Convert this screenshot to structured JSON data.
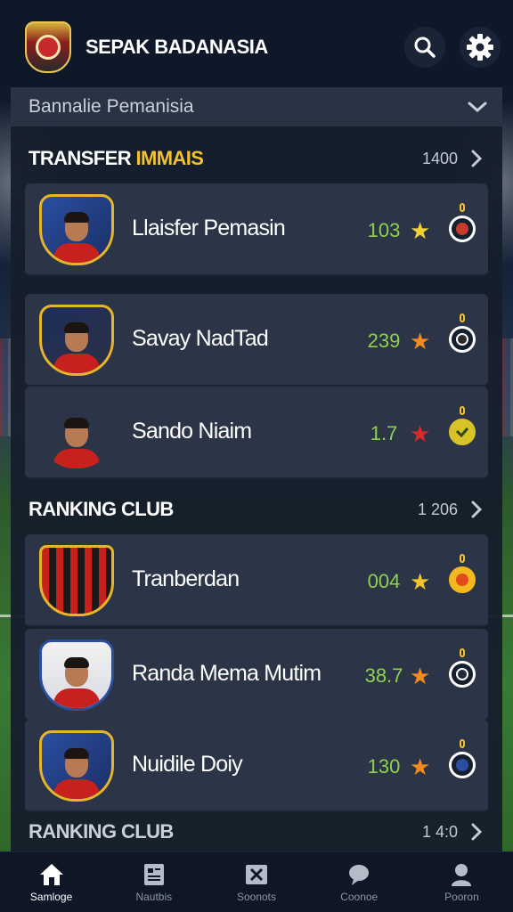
{
  "header": {
    "title": "SEPAK BADANASIA",
    "search_icon": "search-icon",
    "settings_icon": "gear-icon"
  },
  "dropdown": {
    "value": "Bannalie Pemanisia",
    "icon": "chevron-down-icon"
  },
  "sections": [
    {
      "title_main": "TRANSFER ",
      "title_accent": "IMMAIS",
      "count": "1400",
      "players": [
        {
          "name": "Llaisfer Pemasin",
          "score": "103",
          "star_color": "#f4d22f",
          "badge_color": "#c73a2e"
        },
        {
          "name": "Savay NadTad",
          "score": "239",
          "star_color": "#f28a1e",
          "badge_color": "#2b2b2b"
        },
        {
          "name": "Sando Niaim",
          "score": "1.7",
          "star_color": "#d92a2a",
          "badge_color": "#d8c22a"
        }
      ]
    },
    {
      "title_main": "RANKING CLUB",
      "title_accent": "",
      "count": "1 206",
      "players": [
        {
          "name": "Tranberdan",
          "score": "004",
          "star_color": "#f4c22f",
          "badge_color": "#e04a1e"
        },
        {
          "name": "Randa Mema Mutim",
          "score": "38.7",
          "star_color": "#f28a1e",
          "badge_color": "#1f2a3b"
        },
        {
          "name": "Nuidile Doiy",
          "score": "130",
          "star_color": "#f28a1e",
          "badge_color": "#2a4fa0"
        }
      ]
    },
    {
      "title_main": "RANKING CLUB",
      "title_accent": "",
      "count": "1 4:0"
    }
  ],
  "tabs": [
    {
      "label": "Samloge",
      "icon": "home-icon",
      "active": true
    },
    {
      "label": "Nautbis",
      "icon": "clipboard-icon",
      "active": false
    },
    {
      "label": "Soonots",
      "icon": "close-box-icon",
      "active": false
    },
    {
      "label": "Coonoe",
      "icon": "chat-icon",
      "active": false
    },
    {
      "label": "Pooron",
      "icon": "user-icon",
      "active": false
    }
  ],
  "colors": {
    "accent": "#f2c233",
    "score": "#8fd14f",
    "card": "#2b3547",
    "background": "#0f1828"
  }
}
